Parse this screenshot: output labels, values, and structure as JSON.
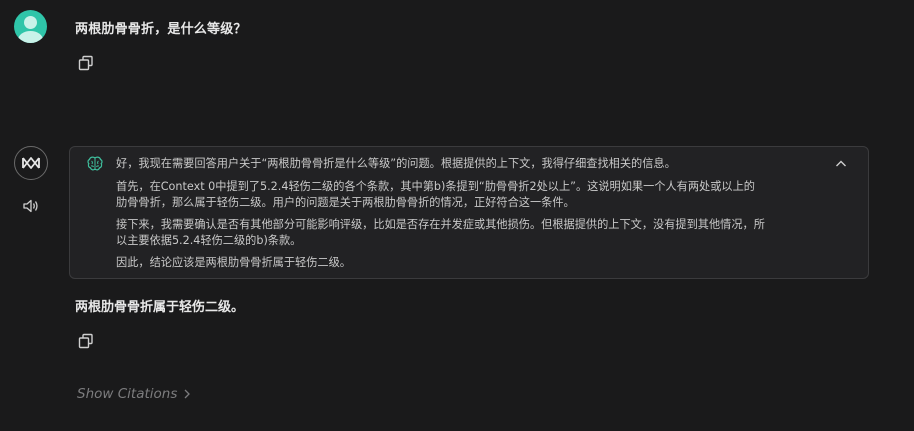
{
  "user_message": {
    "text": "两根肋骨骨折，是什么等级？"
  },
  "thinking": {
    "paragraphs": [
      [
        "好，我现在需要回答用户关于“两根肋骨骨折是什么等级”的问题。根据提供的上下文，我得仔细查找相关的信息。"
      ],
      [
        "首先，在Context 0中提到了5.2.4轻伤二级的各个条款，其中第b)条提到“肋骨骨折2处以上”。这说明如果一个人有两处或以上的",
        "肋骨骨折，那么属于轻伤二级。用户的问题是关于两根肋骨骨折的情况，正好符合这一条件。"
      ],
      [
        "接下来，我需要确认是否有其他部分可能影响评级，比如是否存在并发症或其他损伤。但根据提供的上下文，没有提到其他情况，所",
        "以主要依据5.2.4轻伤二级的b)条款。"
      ],
      [
        "因此，结论应该是两根肋骨骨折属于轻伤二级。"
      ]
    ]
  },
  "answer": {
    "text": "两根肋骨骨折属于轻伤二级。"
  },
  "citations": {
    "label": "Show Citations"
  },
  "colors": {
    "background": "#1a1a1b",
    "accent": "#2fc5a9",
    "think_box": "#222224"
  }
}
